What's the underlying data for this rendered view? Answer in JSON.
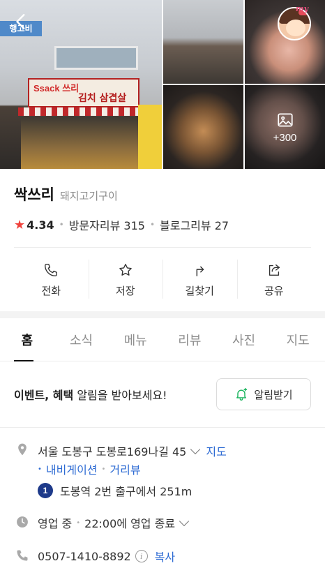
{
  "gallery": {
    "more_count": "+300",
    "main_sign_text": "Ssack 쓰리",
    "main_sign_menu": "김치 삼겹살",
    "top_sign": "행고비",
    "avatar_label": "my"
  },
  "place": {
    "name": "싹쓰리",
    "category": "돼지고기구이",
    "rating": "4.34",
    "visitor_reviews": "방문자리뷰 315",
    "blog_reviews": "블로그리뷰 27"
  },
  "actions": [
    {
      "label": "전화",
      "icon": "phone-icon"
    },
    {
      "label": "저장",
      "icon": "star-icon"
    },
    {
      "label": "길찾기",
      "icon": "directions-icon"
    },
    {
      "label": "공유",
      "icon": "share-icon"
    }
  ],
  "tabs": [
    {
      "label": "홈",
      "active": true
    },
    {
      "label": "소식"
    },
    {
      "label": "메뉴"
    },
    {
      "label": "리뷰"
    },
    {
      "label": "사진"
    },
    {
      "label": "지도"
    }
  ],
  "notice": {
    "text_bold": "이벤트, 혜택",
    "text_rest": " 알림을 받아보세요!",
    "button_label": "알림받기"
  },
  "address": {
    "text": "서울 도봉구 도봉로169나길 45",
    "map_link": "지도",
    "navigation_link": "내비게이션",
    "street_view_link": "거리뷰"
  },
  "subway": {
    "line": "1",
    "line_color": "#1e3a8a",
    "text": "도봉역 2번 출구에서 251m"
  },
  "hours": {
    "status": "영업 중",
    "detail": "22:00에 영업 종료"
  },
  "phone": {
    "number": "0507-1410-8892",
    "copy_label": "복사"
  },
  "colors": {
    "accent_blue": "#2c6ad3",
    "star_red": "#f0423c",
    "notify_green": "#17b35b"
  }
}
